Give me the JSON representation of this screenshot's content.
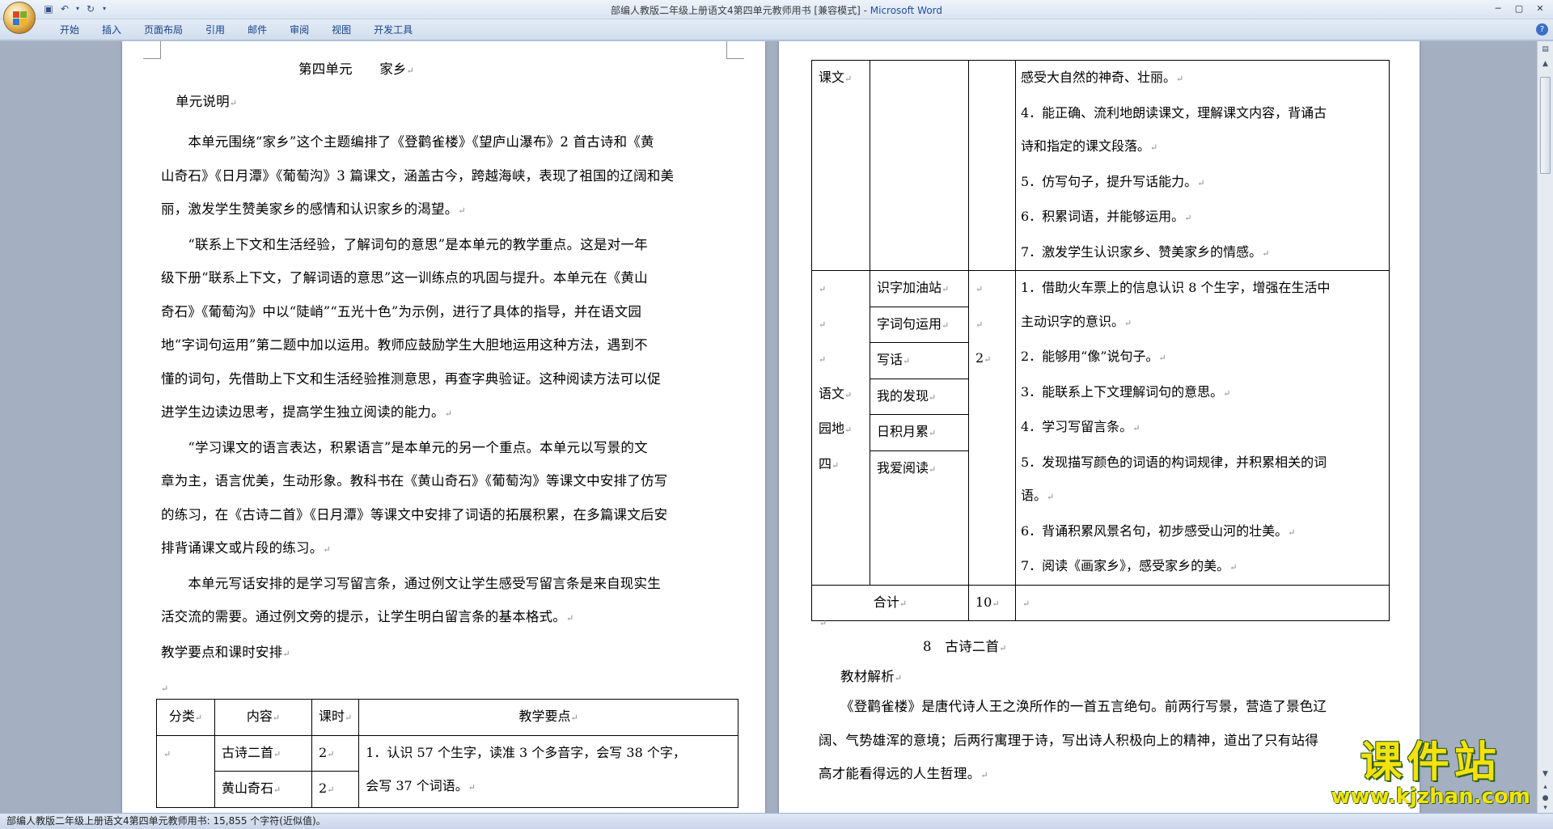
{
  "window": {
    "title": "部编人教版二年级上册语文4第四单元教师用书 [兼容模式] - ",
    "app_name": "Microsoft Word"
  },
  "ribbon": {
    "tabs": [
      "开始",
      "插入",
      "页面布局",
      "引用",
      "邮件",
      "审阅",
      "视图",
      "开发工具"
    ]
  },
  "status_bar": "部编人教版二年级上册语文4第四单元教师用书: 15,855 个字符(近似值)。",
  "left_page": {
    "title": "第四单元　　家乡",
    "section1": "单元说明",
    "paragraphs": [
      [
        "　　本单元围绕“家乡”这个主题编排了《登鹳雀楼》《望庐山瀑布》2 首古诗和《黄",
        "山奇石》《日月潭》《葡萄沟》3 篇课文，涵盖古今，跨越海峡，表现了祖国的辽阔和美",
        "丽，激发学生赞美家乡的感情和认识家乡的渴望。"
      ],
      [
        "　　“联系上下文和生活经验，了解词句的意思”是本单元的教学重点。这是对一年",
        "级下册“联系上下文，了解词语的意思”这一训练点的巩固与提升。本单元在《黄山",
        "奇石》《葡萄沟》中以“陡峭”“五光十色”为示例，进行了具体的指导，并在语文园",
        "地“字词句运用”第二题中加以运用。教师应鼓励学生大胆地运用这种方法，遇到不",
        "懂的词句，先借助上下文和生活经验推测意思，再查字典验证。这种阅读方法可以促",
        "进学生边读边思考，提高学生独立阅读的能力。"
      ],
      [
        "　　“学习课文的语言表达，积累语言”是本单元的另一个重点。本单元以写景的文",
        "章为主，语言优美，生动形象。教科书在《黄山奇石》《葡萄沟》等课文中安排了仿写",
        "的练习，在《古诗二首》《日月潭》等课文中安排了词语的拓展积累，在多篇课文后安",
        "排背诵课文或片段的练习。"
      ],
      [
        "　　本单元写话安排的是学习写留言条，通过例文让学生感受写留言条是来自现实生",
        "活交流的需要。通过例文旁的提示，让学生明白留言条的基本格式。"
      ]
    ],
    "section2": "教学要点和课时安排",
    "table": {
      "headers": [
        "分类",
        "内容",
        "课时",
        "教学要点"
      ],
      "rows": [
        [
          "",
          "古诗二首",
          "2",
          "1．认识 57 个生字，读准 3 个多音字，会写 38 个字，"
        ],
        [
          "",
          "黄山奇石",
          "2",
          "会写 37 个词语。"
        ]
      ]
    }
  },
  "right_page": {
    "table1": {
      "row1": {
        "category": "课文",
        "lines": [
          "感受大自然的神奇、壮丽。",
          "4．能正确、流利地朗读课文，理解课文内容，背诵古",
          "诗和指定的课文段落。",
          "5．仿写句子，提升写话能力。",
          "6．积累词语，并能够运用。",
          "7．激发学生认识家乡、赞美家乡的情感。"
        ]
      },
      "row2": {
        "category": [
          "语文",
          "园地",
          "四"
        ],
        "items": [
          "识字加油站",
          "字词句运用",
          "写话",
          "我的发现",
          "日积月累",
          "我爱阅读"
        ],
        "hours": "2",
        "lines": [
          "1．借助火车票上的信息认识 8 个生字，增强在生活中",
          "主动识字的意识。",
          "2．能够用“像”说句子。",
          "3．能联系上下文理解词句的意思。",
          "4．学习写留言条。",
          "5．发现描写颜色的词语的构词规律，并积累相关的词",
          "语。",
          "6．背诵积累风景名句，初步感受山河的壮美。",
          "7．阅读《画家乡》，感受家乡的美。"
        ]
      },
      "total": {
        "label": "合计",
        "value": "10"
      }
    },
    "lesson_title": "8　古诗二首",
    "section": "教材解析",
    "para": [
      "《登鹳雀楼》是唐代诗人王之涣所作的一首五言绝句。前两行写景，营造了景色辽",
      "阔、气势雄浑的意境；后两行寓理于诗，写出诗人积极向上的精神，道出了只有站得",
      "高才能看得远的人生哲理。"
    ]
  },
  "watermark": {
    "text": "课件站",
    "url": "www.kjzhan.com"
  },
  "icons": {
    "office": "office-button-icon",
    "save": "save-icon",
    "undo": "undo-icon",
    "redo": "redo-icon",
    "help": "help-icon"
  }
}
